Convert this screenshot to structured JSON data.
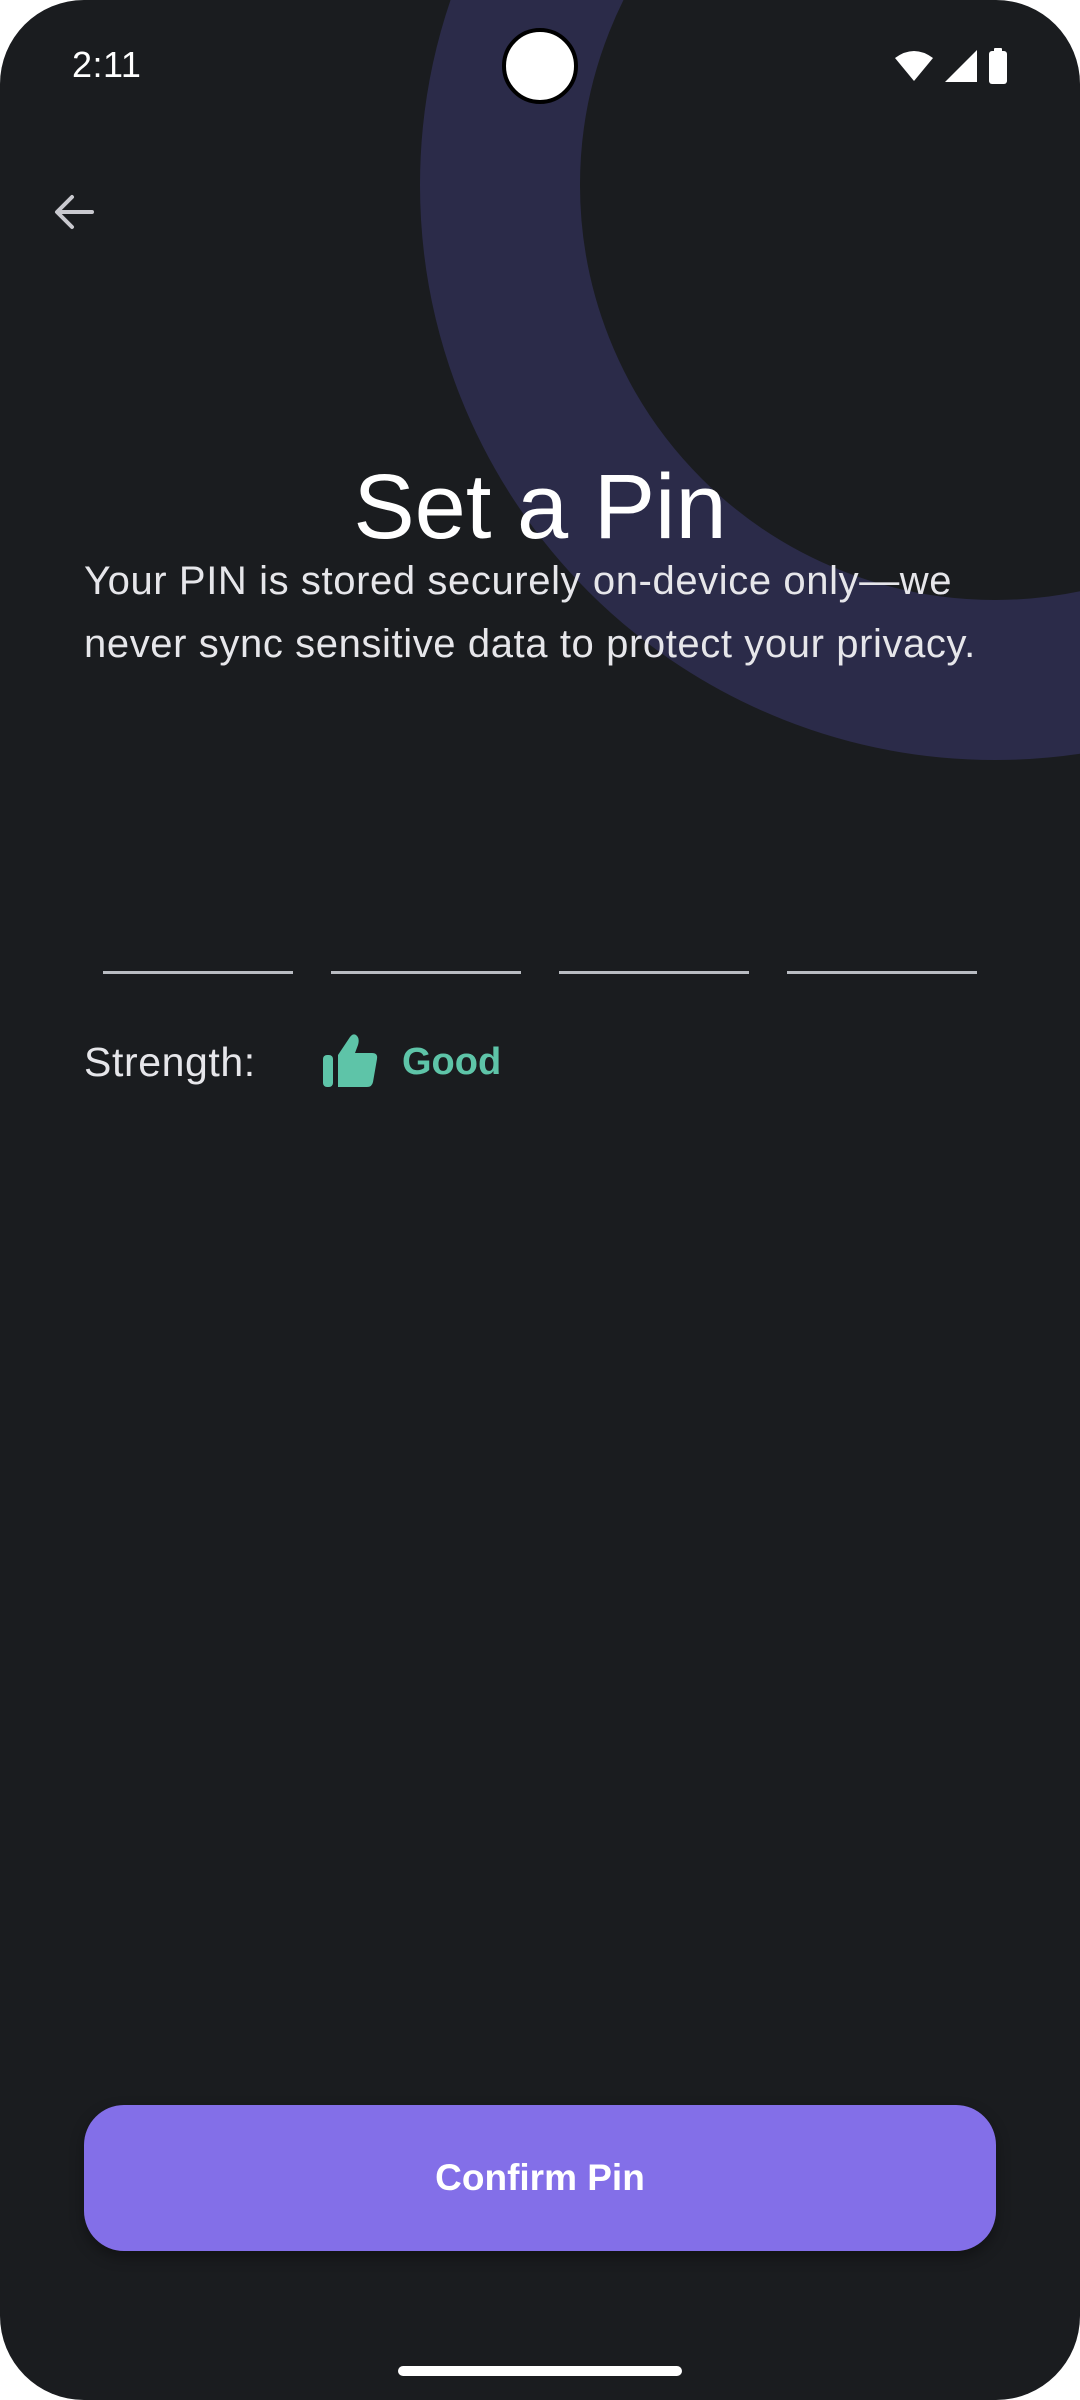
{
  "status_bar": {
    "time": "2:11",
    "icons": [
      "wifi-icon",
      "cellular-signal-icon",
      "battery-icon"
    ]
  },
  "navigation": {
    "back_icon": "arrow-back-icon"
  },
  "page": {
    "title": "Set a Pin",
    "description": "Your PIN is stored securely on-device only—we never sync sensitive data to protect your privacy."
  },
  "pin_input": {
    "length": 4,
    "digits": [
      "",
      "",
      "",
      ""
    ]
  },
  "strength": {
    "label": "Strength:",
    "value": "Good",
    "icon": "thumbs-up-icon",
    "color": "#5ec4a8"
  },
  "confirm_button": {
    "label": "Confirm Pin",
    "color": "#836fe8"
  },
  "theme": {
    "background": "#1a1c1f",
    "decor_ring": "#2b2b49"
  }
}
